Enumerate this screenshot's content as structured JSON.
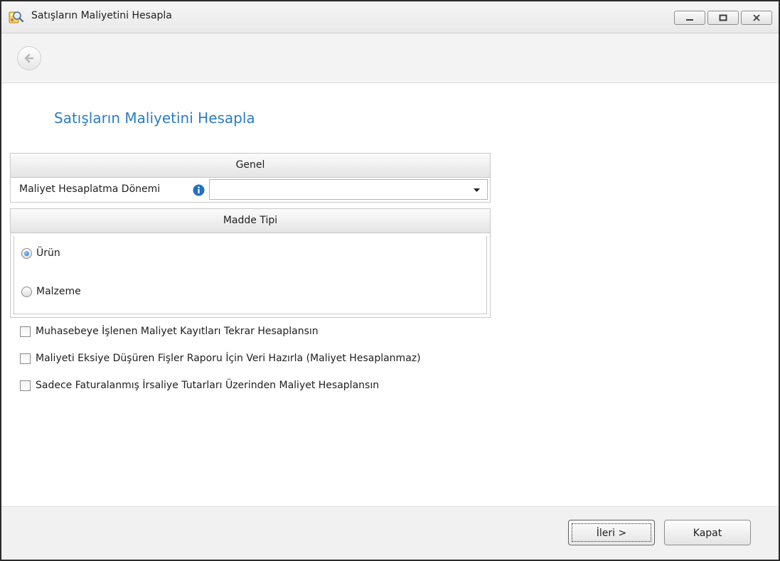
{
  "window": {
    "title": "Satışların Maliyetini Hesapla"
  },
  "page": {
    "heading": "Satışların Maliyetini Hesapla"
  },
  "genel": {
    "header": "Genel",
    "period_label": "Maliyet Hesaplatma Dönemi",
    "period_value": ""
  },
  "madde_tipi": {
    "header": "Madde Tipi",
    "options": [
      {
        "label": "Ürün",
        "selected": true
      },
      {
        "label": "Malzeme",
        "selected": false
      }
    ]
  },
  "options": {
    "items": [
      {
        "label": "Muhasebeye İşlenen Maliyet Kayıtları Tekrar Hesaplansın",
        "checked": false
      },
      {
        "label": "Maliyeti Eksiye Düşüren Fişler Raporu İçin Veri Hazırla (Maliyet Hesaplanmaz)",
        "checked": false
      },
      {
        "label": "Sadece Faturalanmış İrsaliye Tutarları Üzerinden Maliyet Hesaplansın",
        "checked": false
      }
    ]
  },
  "footer": {
    "next_label": "İleri >",
    "close_label": "Kapat"
  },
  "colors": {
    "heading": "#2a7cc2",
    "info_icon": "#1f6fc5"
  },
  "icons": {
    "app": "calculator-magnifier-icon",
    "back": "back-arrow-icon",
    "info": "info-icon",
    "dropdown": "chevron-down-icon"
  }
}
